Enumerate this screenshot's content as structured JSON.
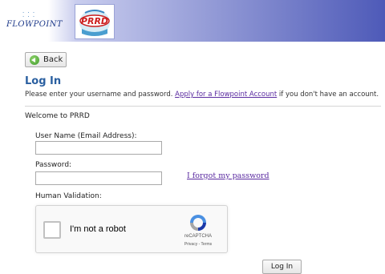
{
  "header": {
    "logo_text": "FLOWPOINT",
    "prrd_logo_text": "PRRD"
  },
  "nav": {
    "back_label": "Back"
  },
  "page": {
    "title": "Log In",
    "intro_before": "Please enter your username and password. ",
    "intro_link": "Apply for a Flowpoint Account",
    "intro_after": " if you don't have an account.",
    "welcome": "Welcome to PRRD"
  },
  "form": {
    "username_label": "User Name (Email Address):",
    "username_value": "",
    "password_label": "Password:",
    "password_value": "",
    "forgot_link": "I forgot my password",
    "validation_label": "Human Validation:",
    "submit_label": "Log In"
  },
  "recaptcha": {
    "label": "I'm not a robot",
    "brand": "reCAPTCHA",
    "links": "Privacy - Terms"
  },
  "colors": {
    "header_gradient_end": "#4e5ab8",
    "title": "#2a5fa0",
    "link": "#5a2aa0"
  },
  "icons": {
    "back": "back-arrow-icon",
    "recaptcha": "recaptcha-icon"
  }
}
